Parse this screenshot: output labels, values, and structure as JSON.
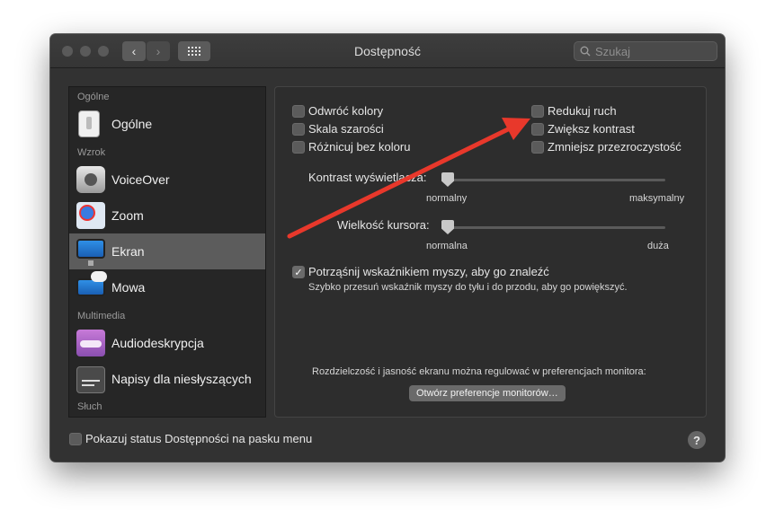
{
  "window": {
    "title": "Dostępność",
    "search_placeholder": "Szukaj",
    "back_icon": "chevron-left-icon",
    "forward_icon": "chevron-right-icon",
    "grid_icon": "grid-icon"
  },
  "sidebar": {
    "headers": [
      "Ogólne",
      "Wzrok",
      "Multimedia",
      "Słuch"
    ],
    "items": [
      {
        "label": "Ogólne",
        "icon": "switch-icon"
      },
      {
        "label": "VoiceOver",
        "icon": "voiceover-icon"
      },
      {
        "label": "Zoom",
        "icon": "zoom-icon"
      },
      {
        "label": "Ekran",
        "icon": "display-icon",
        "selected": true
      },
      {
        "label": "Mowa",
        "icon": "speech-icon"
      },
      {
        "label": "Audiodeskrypcja",
        "icon": "audio-description-icon"
      },
      {
        "label": "Napisy dla niesłyszących",
        "icon": "captions-icon"
      }
    ]
  },
  "display": {
    "options": [
      {
        "label": "Odwróć kolory",
        "checked": false
      },
      {
        "label": "Skala szarości",
        "checked": false
      },
      {
        "label": "Różnicuj bez koloru",
        "checked": false
      },
      {
        "label": "Redukuj ruch",
        "checked": false
      },
      {
        "label": "Zwiększ kontrast",
        "checked": false
      },
      {
        "label": "Zmniejsz przezroczystość",
        "checked": false
      }
    ],
    "contrast": {
      "label": "Kontrast wyświetlacza:",
      "min_label": "normalny",
      "max_label": "maksymalny",
      "value": 0
    },
    "cursor": {
      "label": "Wielkość kursora:",
      "min_label": "normalna",
      "max_label": "duża",
      "value": 0
    },
    "shake": {
      "label": "Potrząśnij wskaźnikiem myszy, aby go znaleźć",
      "checked": true,
      "description": "Szybko przesuń wskaźnik myszy do tyłu i do przodu, aby go powiększyć."
    },
    "monitor_note": "Rozdzielczość i jasność ekranu można regulować w preferencjach monitora:",
    "monitor_button": "Otwórz preferencje monitorów…"
  },
  "footer": {
    "status_label": "Pokazuj status Dostępności na pasku menu",
    "status_checked": false,
    "help_label": "?"
  },
  "annotation": {
    "color": "#e8382b",
    "icon": "red-arrow-annotation"
  }
}
